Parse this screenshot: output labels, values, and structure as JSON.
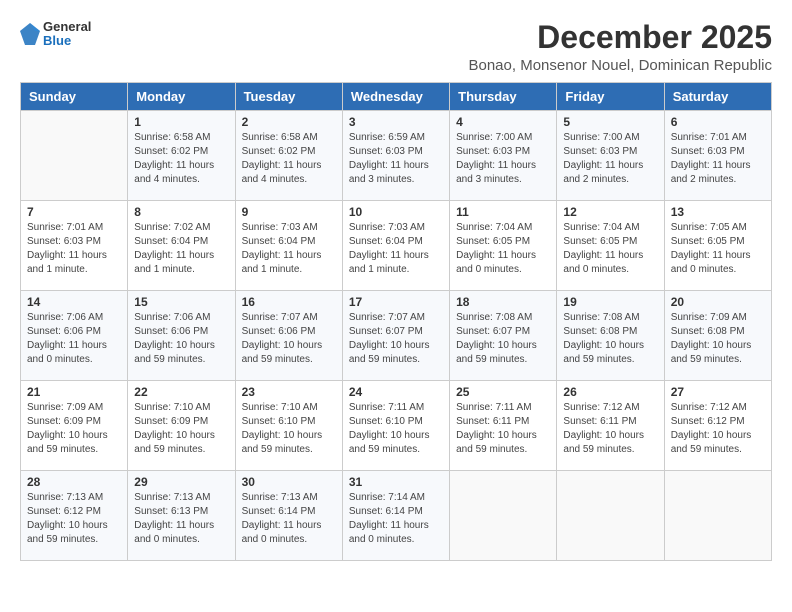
{
  "logo": {
    "general": "General",
    "blue": "Blue"
  },
  "title": "December 2025",
  "location": "Bonao, Monsenor Nouel, Dominican Republic",
  "days_of_week": [
    "Sunday",
    "Monday",
    "Tuesday",
    "Wednesday",
    "Thursday",
    "Friday",
    "Saturday"
  ],
  "weeks": [
    [
      {
        "day": "",
        "info": ""
      },
      {
        "day": "1",
        "info": "Sunrise: 6:58 AM\nSunset: 6:02 PM\nDaylight: 11 hours\nand 4 minutes."
      },
      {
        "day": "2",
        "info": "Sunrise: 6:58 AM\nSunset: 6:02 PM\nDaylight: 11 hours\nand 4 minutes."
      },
      {
        "day": "3",
        "info": "Sunrise: 6:59 AM\nSunset: 6:03 PM\nDaylight: 11 hours\nand 3 minutes."
      },
      {
        "day": "4",
        "info": "Sunrise: 7:00 AM\nSunset: 6:03 PM\nDaylight: 11 hours\nand 3 minutes."
      },
      {
        "day": "5",
        "info": "Sunrise: 7:00 AM\nSunset: 6:03 PM\nDaylight: 11 hours\nand 2 minutes."
      },
      {
        "day": "6",
        "info": "Sunrise: 7:01 AM\nSunset: 6:03 PM\nDaylight: 11 hours\nand 2 minutes."
      }
    ],
    [
      {
        "day": "7",
        "info": "Sunrise: 7:01 AM\nSunset: 6:03 PM\nDaylight: 11 hours\nand 1 minute."
      },
      {
        "day": "8",
        "info": "Sunrise: 7:02 AM\nSunset: 6:04 PM\nDaylight: 11 hours\nand 1 minute."
      },
      {
        "day": "9",
        "info": "Sunrise: 7:03 AM\nSunset: 6:04 PM\nDaylight: 11 hours\nand 1 minute."
      },
      {
        "day": "10",
        "info": "Sunrise: 7:03 AM\nSunset: 6:04 PM\nDaylight: 11 hours\nand 1 minute."
      },
      {
        "day": "11",
        "info": "Sunrise: 7:04 AM\nSunset: 6:05 PM\nDaylight: 11 hours\nand 0 minutes."
      },
      {
        "day": "12",
        "info": "Sunrise: 7:04 AM\nSunset: 6:05 PM\nDaylight: 11 hours\nand 0 minutes."
      },
      {
        "day": "13",
        "info": "Sunrise: 7:05 AM\nSunset: 6:05 PM\nDaylight: 11 hours\nand 0 minutes."
      }
    ],
    [
      {
        "day": "14",
        "info": "Sunrise: 7:06 AM\nSunset: 6:06 PM\nDaylight: 11 hours\nand 0 minutes."
      },
      {
        "day": "15",
        "info": "Sunrise: 7:06 AM\nSunset: 6:06 PM\nDaylight: 10 hours\nand 59 minutes."
      },
      {
        "day": "16",
        "info": "Sunrise: 7:07 AM\nSunset: 6:06 PM\nDaylight: 10 hours\nand 59 minutes."
      },
      {
        "day": "17",
        "info": "Sunrise: 7:07 AM\nSunset: 6:07 PM\nDaylight: 10 hours\nand 59 minutes."
      },
      {
        "day": "18",
        "info": "Sunrise: 7:08 AM\nSunset: 6:07 PM\nDaylight: 10 hours\nand 59 minutes."
      },
      {
        "day": "19",
        "info": "Sunrise: 7:08 AM\nSunset: 6:08 PM\nDaylight: 10 hours\nand 59 minutes."
      },
      {
        "day": "20",
        "info": "Sunrise: 7:09 AM\nSunset: 6:08 PM\nDaylight: 10 hours\nand 59 minutes."
      }
    ],
    [
      {
        "day": "21",
        "info": "Sunrise: 7:09 AM\nSunset: 6:09 PM\nDaylight: 10 hours\nand 59 minutes."
      },
      {
        "day": "22",
        "info": "Sunrise: 7:10 AM\nSunset: 6:09 PM\nDaylight: 10 hours\nand 59 minutes."
      },
      {
        "day": "23",
        "info": "Sunrise: 7:10 AM\nSunset: 6:10 PM\nDaylight: 10 hours\nand 59 minutes."
      },
      {
        "day": "24",
        "info": "Sunrise: 7:11 AM\nSunset: 6:10 PM\nDaylight: 10 hours\nand 59 minutes."
      },
      {
        "day": "25",
        "info": "Sunrise: 7:11 AM\nSunset: 6:11 PM\nDaylight: 10 hours\nand 59 minutes."
      },
      {
        "day": "26",
        "info": "Sunrise: 7:12 AM\nSunset: 6:11 PM\nDaylight: 10 hours\nand 59 minutes."
      },
      {
        "day": "27",
        "info": "Sunrise: 7:12 AM\nSunset: 6:12 PM\nDaylight: 10 hours\nand 59 minutes."
      }
    ],
    [
      {
        "day": "28",
        "info": "Sunrise: 7:13 AM\nSunset: 6:12 PM\nDaylight: 10 hours\nand 59 minutes."
      },
      {
        "day": "29",
        "info": "Sunrise: 7:13 AM\nSunset: 6:13 PM\nDaylight: 11 hours\nand 0 minutes."
      },
      {
        "day": "30",
        "info": "Sunrise: 7:13 AM\nSunset: 6:14 PM\nDaylight: 11 hours\nand 0 minutes."
      },
      {
        "day": "31",
        "info": "Sunrise: 7:14 AM\nSunset: 6:14 PM\nDaylight: 11 hours\nand 0 minutes."
      },
      {
        "day": "",
        "info": ""
      },
      {
        "day": "",
        "info": ""
      },
      {
        "day": "",
        "info": ""
      }
    ]
  ]
}
